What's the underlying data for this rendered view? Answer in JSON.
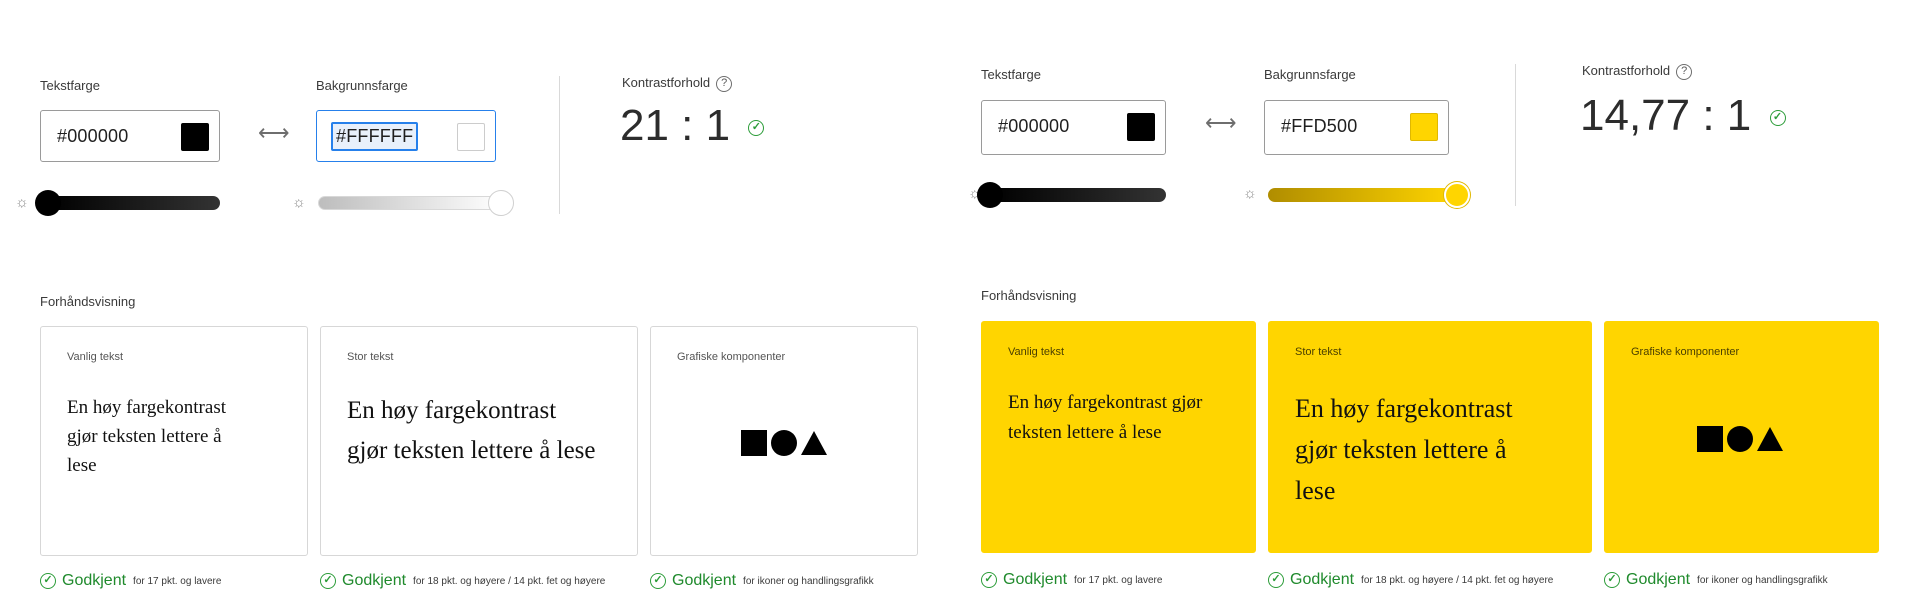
{
  "panels": [
    {
      "text_color_label": "Tekstfarge",
      "bg_color_label": "Bakgrunnsfarge",
      "text_hex": "#000000",
      "bg_hex": "#FFFFFF",
      "text_swatch": "#000000",
      "bg_swatch": "#FFFFFF",
      "contrast_label": "Kontrastforhold",
      "help_icon": "?",
      "contrast_ratio": "21 : 1",
      "text_slider_level": 0.0,
      "bg_slider_level": 1.0,
      "preview_label": "Forhåndsvisning",
      "cards": [
        {
          "title": "Vanlig tekst",
          "sample": "En høy fargekontrast gjør teksten lettere å lese"
        },
        {
          "title": "Stor tekst",
          "sample": "En høy fargekontrast gjør teksten lettere å lese"
        },
        {
          "title": "Grafiske komponenter"
        }
      ],
      "results": [
        {
          "status": "Godkjent",
          "detail": "for 17 pkt. og lavere"
        },
        {
          "status": "Godkjent",
          "detail": "for 18 pkt. og høyere / 14 pkt. fet og høyere"
        },
        {
          "status": "Godkjent",
          "detail": "for ikoner og handlingsgrafikk"
        }
      ],
      "card_bg": "#FFFFFF"
    },
    {
      "text_color_label": "Tekstfarge",
      "bg_color_label": "Bakgrunnsfarge",
      "text_hex": "#000000",
      "bg_hex": "#FFD500",
      "text_swatch": "#000000",
      "bg_swatch": "#FFD500",
      "contrast_label": "Kontrastforhold",
      "help_icon": "?",
      "contrast_ratio": "14,77 : 1",
      "text_slider_level": 0.0,
      "bg_slider_level": 1.0,
      "preview_label": "Forhåndsvisning",
      "cards": [
        {
          "title": "Vanlig tekst",
          "sample": "En høy fargekontrast gjør teksten lettere å lese"
        },
        {
          "title": "Stor tekst",
          "sample": "En høy fargekontrast gjør teksten lettere å lese"
        },
        {
          "title": "Grafiske komponenter"
        }
      ],
      "results": [
        {
          "status": "Godkjent",
          "detail": "for 17 pkt. og lavere"
        },
        {
          "status": "Godkjent",
          "detail": "for 18 pkt. og høyere / 14 pkt. fet og høyere"
        },
        {
          "status": "Godkjent",
          "detail": "for ikoner og handlingsgrafikk"
        }
      ],
      "card_bg": "#FFD500"
    }
  ],
  "icons": {
    "swap": "swap-arrows-icon",
    "brightness": "brightness-icon",
    "help": "help-icon",
    "pass": "check-circle-icon"
  },
  "colors": {
    "pass_green": "#1F8A2C",
    "focus_blue": "#2680EB",
    "accent_yellow": "#FFD500"
  }
}
